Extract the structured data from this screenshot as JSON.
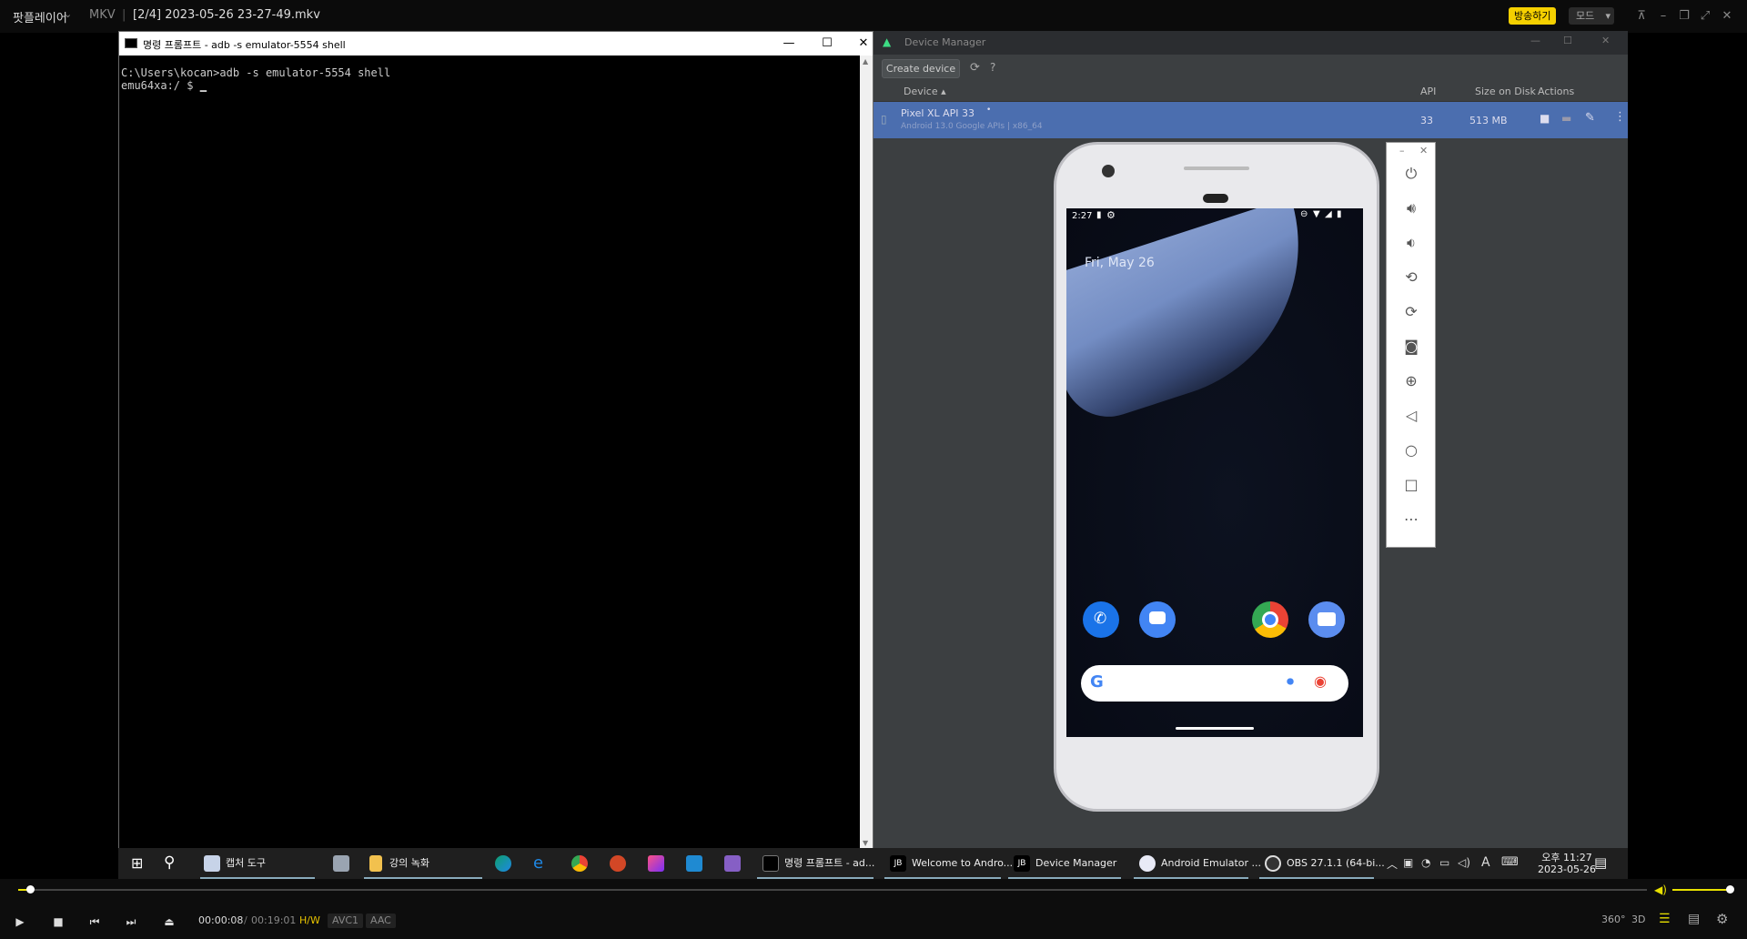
{
  "player": {
    "app_name": "팟플레이어",
    "format": "MKV",
    "file_title": "[2/4] 2023-05-26 23-27-49.mkv",
    "broadcast_label": "방송하기",
    "mode_label": "모드",
    "time_current": "00:00:08",
    "time_separator": "/",
    "time_total": "00:19:01",
    "hw_tag": "H/W",
    "video_codec": "AVC1",
    "audio_codec": "AAC",
    "progress": 0.007,
    "volume": 1.0,
    "right_buttons": [
      "360°",
      "3D"
    ]
  },
  "cmd": {
    "title": "명령 프롬프트 - adb  -s emulator-5554 shell",
    "line1": "C:\\Users\\kocan>adb -s emulator-5554 shell",
    "line2": "emu64xa:/ $ "
  },
  "device_manager": {
    "title": "Device Manager",
    "create_button": "Create device",
    "columns": {
      "device": "Device",
      "api": "API",
      "size": "Size on Disk",
      "actions": "Actions"
    },
    "row": {
      "name": "Pixel XL API 33",
      "subtitle": "Android 13.0 Google APIs | x86_64",
      "api": "33",
      "size": "513 MB"
    }
  },
  "phone": {
    "status_time": "2:27",
    "date": "Fri, May 26"
  },
  "taskbar": {
    "items": [
      {
        "label": "캡처 도구"
      },
      {
        "label": "강의 녹화"
      },
      {
        "label": "명령 프롬프트 - ad..."
      },
      {
        "label": "Welcome to Andro..."
      },
      {
        "label": "Device Manager"
      },
      {
        "label": "Android Emulator ..."
      },
      {
        "label": "OBS 27.1.1 (64-bi..."
      }
    ],
    "clock_ampm_time": "오후 11:27",
    "clock_date": "2023-05-26",
    "ime": "A"
  },
  "colors": {
    "accent_yellow": "#e8e000",
    "dm_selected_row": "#4b6eaf",
    "chrome_red": "#ea4335",
    "google_blue": "#4285f4"
  }
}
